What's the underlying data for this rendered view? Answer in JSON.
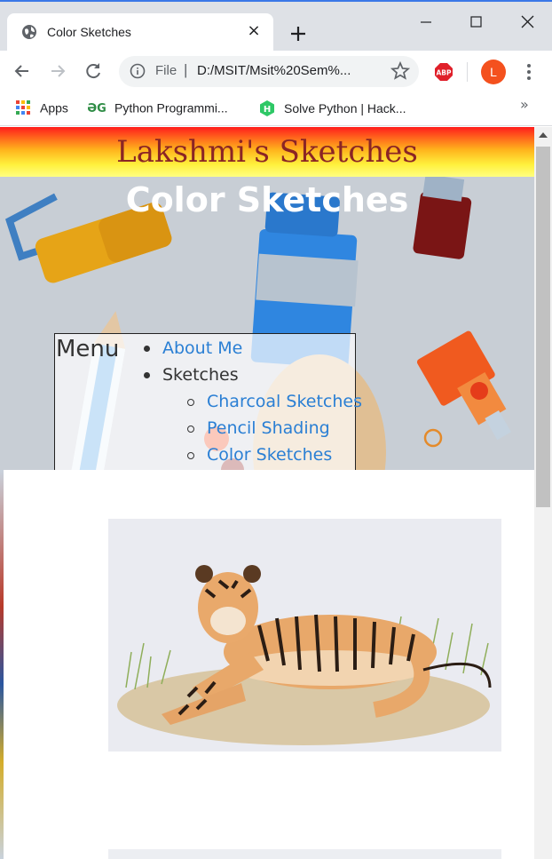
{
  "browser": {
    "tab_title": "Color Sketches",
    "tab_close": "×",
    "omnibox": {
      "scheme_label": "File",
      "separator": "|",
      "url": "D:/MSIT/Msit%20Sem%..."
    },
    "profile_initial": "L",
    "bookmarks": [
      {
        "label": "Apps"
      },
      {
        "label": "Python Programmi..."
      },
      {
        "label": "Solve Python | Hack..."
      }
    ],
    "bookmarks_overflow": "»"
  },
  "page": {
    "site_title": "Lakshmi's Sketches",
    "heading": "Color Sketches",
    "menu": {
      "title": "Menu",
      "items": [
        {
          "label": "About Me"
        },
        {
          "label": "Sketches"
        }
      ],
      "subitems": [
        {
          "label": "Charcoal Sketches"
        },
        {
          "label": "Pencil Shading"
        },
        {
          "label": "Color Sketches"
        }
      ]
    }
  },
  "colors": {
    "link": "#2a7fd4",
    "site_title": "#8b2525",
    "chrome_bg": "#dee1e6",
    "profile": "#f4511e"
  },
  "icons": [
    "globe-icon",
    "plus-icon",
    "minimize-icon",
    "maximize-icon",
    "close-icon",
    "back-arrow-icon",
    "forward-arrow-icon",
    "reload-icon",
    "info-icon",
    "star-icon",
    "adblock-icon",
    "more-vert-icon",
    "apps-grid-icon",
    "gfg-icon",
    "hackerrank-icon"
  ]
}
